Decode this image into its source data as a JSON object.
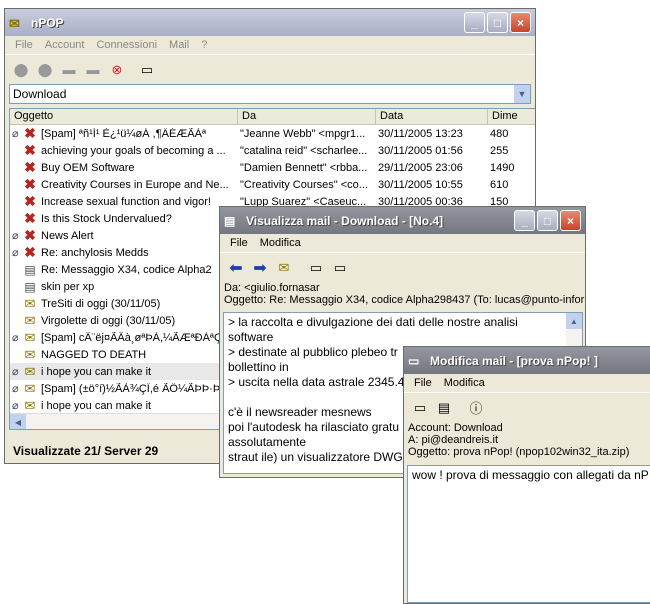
{
  "main": {
    "title": "nPOP",
    "menu": [
      "File",
      "Account",
      "Connessioni",
      "Mail",
      "?"
    ],
    "account": "Download",
    "columns": [
      "Oggetto",
      "Da",
      "Data",
      "Dime"
    ],
    "rows": [
      {
        "clip": "0",
        "icon": "x",
        "subject": "[Spam] ªñ¹Í¹ È¿¹ü¼øÁ ,¶ÄÉÆÃÀª",
        "from": "\"Jeanne Webb\" <mpgr1...",
        "date": "30/11/2005 13:23",
        "size": "480"
      },
      {
        "clip": "",
        "icon": "x",
        "subject": "achieving your goals of becoming a ...",
        "from": "\"catalina reid\" <scharlee...",
        "date": "30/11/2005 01:56",
        "size": "255"
      },
      {
        "clip": "",
        "icon": "x",
        "subject": "Buy OEM Software",
        "from": "\"Damien Bennett\" <rbba...",
        "date": "29/11/2005 23:06",
        "size": "1490"
      },
      {
        "clip": "",
        "icon": "x",
        "subject": "Creativity Courses in Europe and Ne...",
        "from": "\"Creativity Courses\" <co...",
        "date": "30/11/2005 10:55",
        "size": "610"
      },
      {
        "clip": "",
        "icon": "x",
        "subject": "Increase sexual function and vigor!",
        "from": "\"Lupp Suarez\" <Caseuc...",
        "date": "30/11/2005 00:36",
        "size": "150"
      },
      {
        "clip": "",
        "icon": "x",
        "subject": "Is this Stock Undervalued?",
        "from": "",
        "date": "",
        "size": ""
      },
      {
        "clip": "0",
        "icon": "x",
        "subject": "News Alert",
        "from": "",
        "date": "",
        "size": ""
      },
      {
        "clip": "0",
        "icon": "x",
        "subject": "Re: anchylosis Medds",
        "from": "",
        "date": "",
        "size": ""
      },
      {
        "clip": "",
        "icon": "doc",
        "subject": "Re: Messaggio X34, codice Alpha2",
        "from": "",
        "date": "",
        "size": ""
      },
      {
        "clip": "",
        "icon": "doc",
        "subject": "skin per xp",
        "from": "",
        "date": "",
        "size": ""
      },
      {
        "clip": "",
        "icon": "env",
        "subject": "TreSiti di oggi (30/11/05)",
        "from": "",
        "date": "",
        "size": ""
      },
      {
        "clip": "",
        "icon": "env",
        "subject": "Virgolette di oggi (30/11/05)",
        "from": "",
        "date": "",
        "size": ""
      },
      {
        "clip": "0",
        "icon": "env",
        "subject": "[Spam] cÂ¨ëj¤ÃÂà¸øªÞÀ,¼ÃÆªÐÀªÇàº",
        "from": "",
        "date": "",
        "size": ""
      },
      {
        "clip": "",
        "icon": "env",
        "subject": "NAGGED TO DEATH",
        "from": "",
        "date": "",
        "size": ""
      },
      {
        "clip": "0",
        "icon": "env",
        "subject": "i hope you can make it",
        "from": "",
        "date": "",
        "size": ""
      },
      {
        "clip": "0",
        "icon": "env",
        "subject": "[Spam] (±ö°í)½ÃÀ¾ÇÏ,é ÃÖ¼ÃÞÞ·Þ¿¡",
        "from": "",
        "date": "",
        "size": ""
      },
      {
        "clip": "0",
        "icon": "env",
        "subject": "i hope you can make it",
        "from": "",
        "date": "",
        "size": ""
      }
    ],
    "status": "Visualizzate 21/ Server 29"
  },
  "view": {
    "title": "Visualizza mail - Download - [No.4]",
    "menu": [
      "File",
      "Modifica"
    ],
    "from_line": "Da: <giulio.fornasar",
    "subject_line": "Oggetto: Re: Messaggio X34, codice Alpha298437 (To: lucas@punto-informa",
    "body": [
      "> la raccolta e divulgazione dei dati delle nostre analisi",
      "software",
      "> destinate al pubblico plebeo tr",
      "bollettino in",
      "> uscita nella data astrale 2345.4",
      "",
      "c'è il newsreader mesnews",
      "poi l'autodesk ha rilasciato gratu",
      "assolutamente",
      "straut ile) un visualizzatore DWG"
    ]
  },
  "edit": {
    "title": "Modifica mail - [prova nPop! ]",
    "menu": [
      "File",
      "Modifica"
    ],
    "account_line": "Account: Download",
    "to_line": "A: pi@deandreis.it",
    "subject_line": "Oggetto: prova nPop!  (npop102win32_ita.zip)",
    "body": "wow ! prova di messaggio con allegati da nP"
  }
}
